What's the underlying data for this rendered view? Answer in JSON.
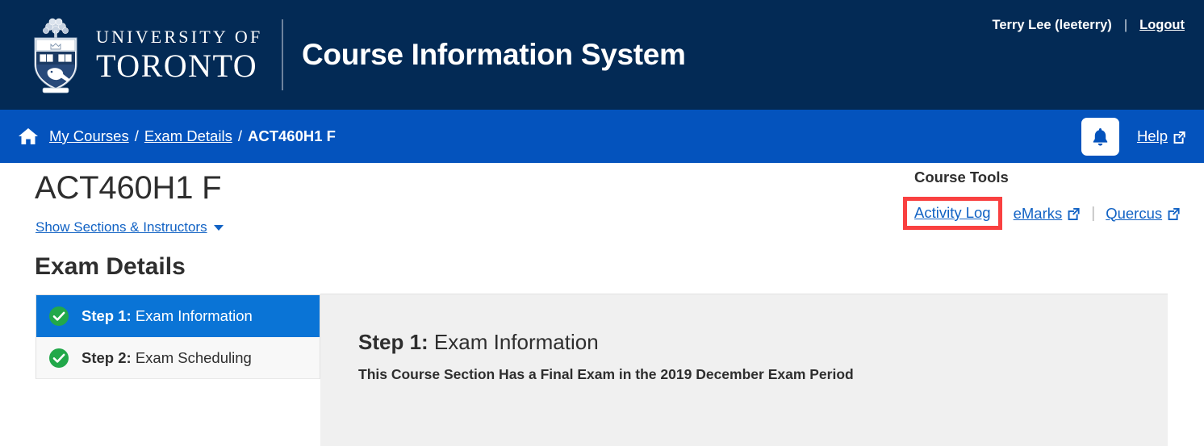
{
  "header": {
    "university_line1": "UNIVERSITY OF",
    "university_line2": "TORONTO",
    "app_title": "Course Information System",
    "user_name": "Terry Lee (leeterry)",
    "separator": "|",
    "logout_label": "Logout",
    "logo_icon": "uoft-crest-icon",
    "background_color": "#032a55"
  },
  "breadcrumb": {
    "home_icon": "home-icon",
    "items": [
      {
        "label": "My Courses",
        "link": true
      },
      {
        "label": "Exam Details",
        "link": true
      },
      {
        "label": "ACT460H1 F",
        "link": false
      }
    ],
    "separator": "/",
    "notifications_icon": "bell-icon",
    "help_label": "Help",
    "help_icon": "external-link-icon",
    "background_color": "#0453bd"
  },
  "page": {
    "title": "ACT460H1 F",
    "sections_toggle_label": "Show Sections & Instructors",
    "sections_toggle_icon": "chevron-down-icon"
  },
  "course_tools": {
    "heading": "Course Tools",
    "items": [
      {
        "label": "Activity Log",
        "external": false,
        "highlighted": true
      },
      {
        "label": "eMarks",
        "external": true,
        "highlighted": false
      },
      {
        "label": "Quercus",
        "external": true,
        "highlighted": false
      }
    ],
    "separator": "|",
    "highlight_color": "#f94040",
    "link_color": "#1162c4"
  },
  "exam_details": {
    "heading": "Exam Details",
    "steps": [
      {
        "number": "Step 1:",
        "name": "Exam Information",
        "status_icon": "check-circle-icon",
        "active": true
      },
      {
        "number": "Step 2:",
        "name": "Exam Scheduling",
        "status_icon": "check-circle-icon",
        "active": false
      }
    ],
    "active_color": "#0a74d6",
    "check_color": "#22a84a"
  },
  "panel": {
    "step_number": "Step 1:",
    "step_name": "Exam Information",
    "description": "This Course Section Has a Final Exam in the 2019 December Exam Period",
    "background_color": "#f0f0f0"
  }
}
